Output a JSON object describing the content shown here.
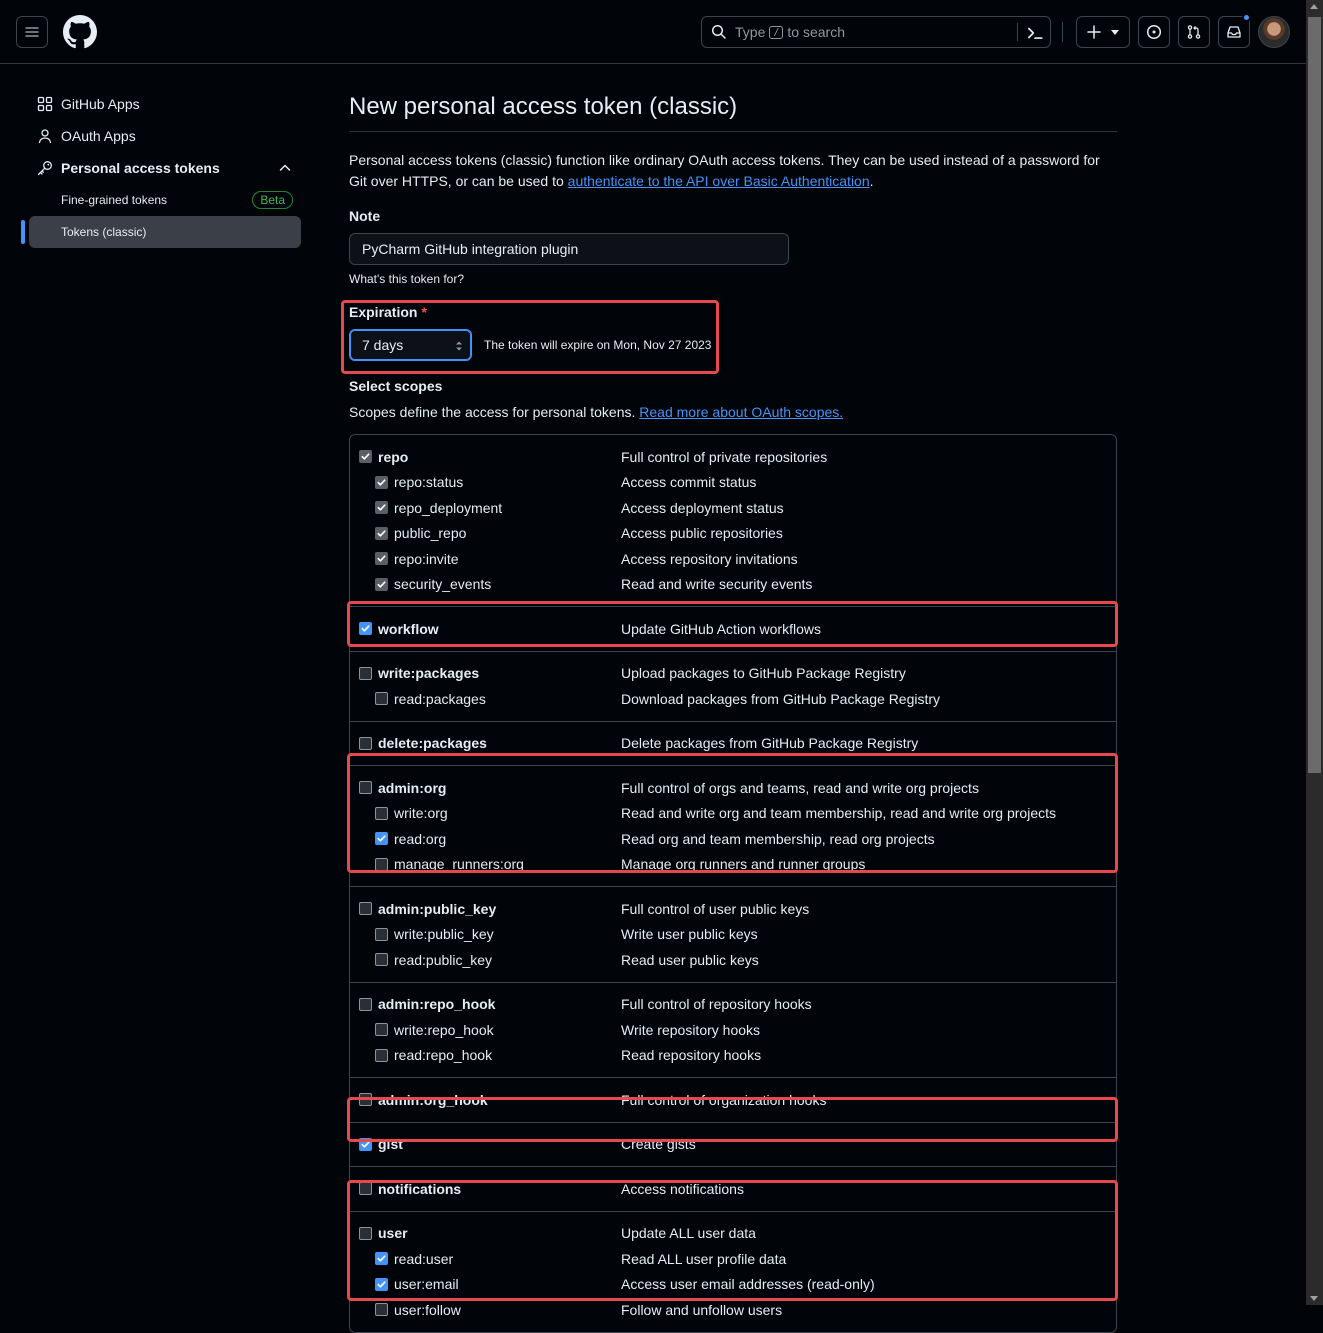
{
  "header": {
    "search_prefix": "Type",
    "search_key": "/",
    "search_suffix": "to search"
  },
  "sidebar": {
    "items": [
      {
        "label": "GitHub Apps",
        "icon": "apps-icon"
      },
      {
        "label": "OAuth Apps",
        "icon": "person-icon"
      },
      {
        "label": "Personal access tokens",
        "icon": "key-icon"
      }
    ],
    "subitems": [
      {
        "label": "Fine-grained tokens",
        "badge": "Beta"
      },
      {
        "label": "Tokens (classic)"
      }
    ]
  },
  "main": {
    "title": "New personal access token (classic)",
    "intro_text": "Personal access tokens (classic) function like ordinary OAuth access tokens. They can be used instead of a password for Git over HTTPS, or can be used to ",
    "intro_link": "authenticate to the API over Basic Authentication",
    "intro_end": ".",
    "note_label": "Note",
    "note_value": "PyCharm GitHub integration plugin",
    "note_hint": "What's this token for?",
    "expiration_label": "Expiration",
    "expiration_required": "*",
    "expiration_value": "7 days",
    "expiration_text": "The token will expire on Mon, Nov 27 2023",
    "scopes_label": "Select scopes",
    "scopes_desc": "Scopes define the access for personal tokens. ",
    "scopes_link": "Read more about OAuth scopes."
  },
  "scope_groups": [
    {
      "rows": [
        {
          "name": "repo",
          "desc": "Full control of private repositories",
          "parent": true,
          "state": "inherited"
        },
        {
          "name": "repo:status",
          "desc": "Access commit status",
          "parent": false,
          "state": "inherited"
        },
        {
          "name": "repo_deployment",
          "desc": "Access deployment status",
          "parent": false,
          "state": "inherited"
        },
        {
          "name": "public_repo",
          "desc": "Access public repositories",
          "parent": false,
          "state": "inherited"
        },
        {
          "name": "repo:invite",
          "desc": "Access repository invitations",
          "parent": false,
          "state": "inherited"
        },
        {
          "name": "security_events",
          "desc": "Read and write security events",
          "parent": false,
          "state": "inherited"
        }
      ]
    },
    {
      "rows": [
        {
          "name": "workflow",
          "desc": "Update GitHub Action workflows",
          "parent": true,
          "state": "checked"
        }
      ]
    },
    {
      "rows": [
        {
          "name": "write:packages",
          "desc": "Upload packages to GitHub Package Registry",
          "parent": true,
          "state": "unchecked"
        },
        {
          "name": "read:packages",
          "desc": "Download packages from GitHub Package Registry",
          "parent": false,
          "state": "unchecked"
        }
      ]
    },
    {
      "rows": [
        {
          "name": "delete:packages",
          "desc": "Delete packages from GitHub Package Registry",
          "parent": true,
          "state": "unchecked"
        }
      ]
    },
    {
      "rows": [
        {
          "name": "admin:org",
          "desc": "Full control of orgs and teams, read and write org projects",
          "parent": true,
          "state": "unchecked"
        },
        {
          "name": "write:org",
          "desc": "Read and write org and team membership, read and write org projects",
          "parent": false,
          "state": "unchecked"
        },
        {
          "name": "read:org",
          "desc": "Read org and team membership, read org projects",
          "parent": false,
          "state": "checked"
        },
        {
          "name": "manage_runners:org",
          "desc": "Manage org runners and runner groups",
          "parent": false,
          "state": "unchecked"
        }
      ]
    },
    {
      "rows": [
        {
          "name": "admin:public_key",
          "desc": "Full control of user public keys",
          "parent": true,
          "state": "unchecked"
        },
        {
          "name": "write:public_key",
          "desc": "Write user public keys",
          "parent": false,
          "state": "unchecked"
        },
        {
          "name": "read:public_key",
          "desc": "Read user public keys",
          "parent": false,
          "state": "unchecked"
        }
      ]
    },
    {
      "rows": [
        {
          "name": "admin:repo_hook",
          "desc": "Full control of repository hooks",
          "parent": true,
          "state": "unchecked"
        },
        {
          "name": "write:repo_hook",
          "desc": "Write repository hooks",
          "parent": false,
          "state": "unchecked"
        },
        {
          "name": "read:repo_hook",
          "desc": "Read repository hooks",
          "parent": false,
          "state": "unchecked"
        }
      ]
    },
    {
      "rows": [
        {
          "name": "admin:org_hook",
          "desc": "Full control of organization hooks",
          "parent": true,
          "state": "unchecked"
        }
      ]
    },
    {
      "rows": [
        {
          "name": "gist",
          "desc": "Create gists",
          "parent": true,
          "state": "checked"
        }
      ]
    },
    {
      "rows": [
        {
          "name": "notifications",
          "desc": "Access notifications",
          "parent": true,
          "state": "unchecked"
        }
      ]
    },
    {
      "rows": [
        {
          "name": "user",
          "desc": "Update ALL user data",
          "parent": true,
          "state": "unchecked"
        },
        {
          "name": "read:user",
          "desc": "Read ALL user profile data",
          "parent": false,
          "state": "checked"
        },
        {
          "name": "user:email",
          "desc": "Access user email addresses (read-only)",
          "parent": false,
          "state": "checked"
        },
        {
          "name": "user:follow",
          "desc": "Follow and unfollow users",
          "parent": false,
          "state": "unchecked"
        }
      ]
    }
  ],
  "colors": {
    "accent": "#4493f8",
    "annotation": "#e5484d",
    "background": "#010409",
    "success": "#3fb950"
  }
}
